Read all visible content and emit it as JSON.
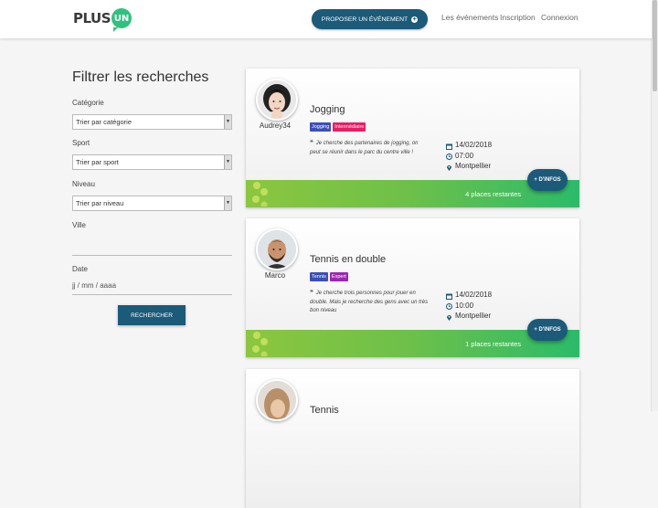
{
  "header": {
    "logo_plus": "PLUS",
    "logo_un": "UN",
    "propose_label": "PROPOSER UN ÉVÉNEMENT",
    "nav": [
      "Les événements",
      "Inscription",
      "Connexion"
    ]
  },
  "filters": {
    "title": "Filtrer les recherches",
    "category_label": "Catégorie",
    "category_value": "Trier par catégorie",
    "sport_label": "Sport",
    "sport_value": "Trier par sport",
    "level_label": "Niveau",
    "level_value": "Trier par niveau",
    "city_label": "Ville",
    "city_value": "",
    "date_label": "Date",
    "date_placeholder": "jj / mm / aaaa",
    "search_label": "RECHERCHER"
  },
  "events": [
    {
      "user": "Audrey34",
      "title": "Jogging",
      "tags": [
        {
          "label": "Jogging",
          "color": "#3b4fb8"
        },
        {
          "label": "Intermédiaire",
          "color": "#e91e63"
        }
      ],
      "description": "Je cherche des partenaires de jogging, on peut se réunir dans le parc du centre ville !",
      "date": "14/02/2018",
      "time": "07:00",
      "place": "Montpellier",
      "places_left": "4 places restantes",
      "infos_label": "+ D'INFOS"
    },
    {
      "user": "Marco",
      "title": "Tennis en double",
      "tags": [
        {
          "label": "Tennis",
          "color": "#3b4fb8"
        },
        {
          "label": "Expert",
          "color": "#9c27b0"
        }
      ],
      "description": "Je cherche trois personnes pour jouer en double. Mais je recherche des gens avec un très bon niveau",
      "date": "14/02/2018",
      "time": "10:00",
      "place": "Montpellier",
      "places_left": "1 places restantes",
      "infos_label": "+ D'INFOS"
    },
    {
      "title": "Tennis"
    }
  ],
  "colors": {
    "primary": "#1b5a78",
    "accent": "#2ec27e"
  }
}
